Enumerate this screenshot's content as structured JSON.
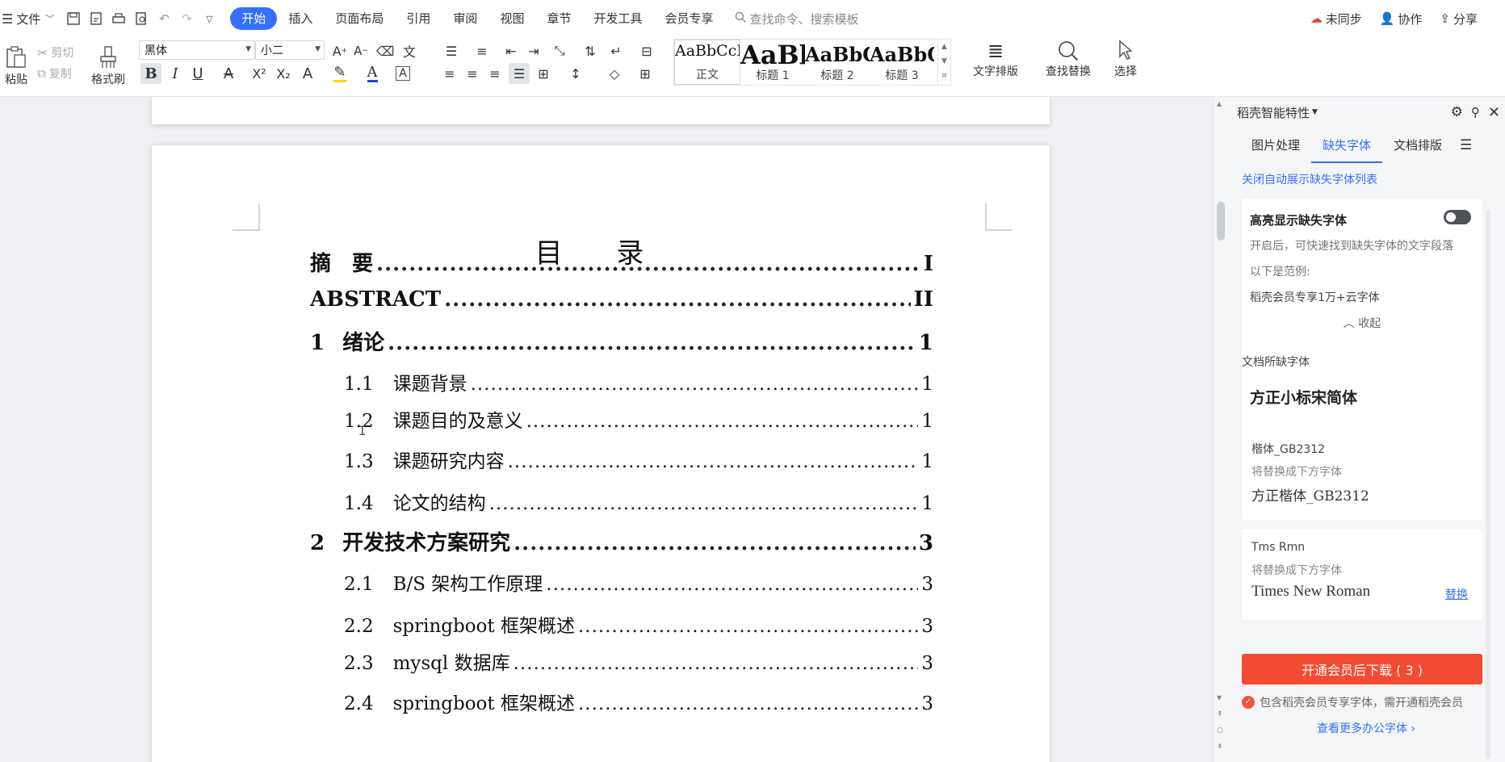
{
  "menubar": {
    "menu_label": "文件",
    "tabs": [
      "开始",
      "插入",
      "页面布局",
      "引用",
      "审阅",
      "视图",
      "章节",
      "开发工具",
      "会员专享"
    ],
    "search_placeholder": "查找命令、搜索模板",
    "right": {
      "sync": "未同步",
      "collab": "协作",
      "share": "分享"
    }
  },
  "ribbon": {
    "paste": "粘贴",
    "cut": "剪切",
    "copy": "复制",
    "format_painter": "格式刷",
    "font_name": "黑体",
    "font_size": "小二",
    "styles": [
      {
        "sample": "AaBbCcDd",
        "name": "正文"
      },
      {
        "sample": "AaBl",
        "name": "标题 1"
      },
      {
        "sample": "AaBbC",
        "name": "标题 2"
      },
      {
        "sample": "AaBbC",
        "name": "标题 3"
      }
    ],
    "text_layout": "文字排版",
    "find_replace": "查找替换",
    "select": "选择"
  },
  "document": {
    "toc_title": "目 录",
    "entries": [
      {
        "level": 1,
        "num": "",
        "title": "摘　要",
        "page": "I"
      },
      {
        "level": 1,
        "num": "",
        "title": "ABSTRACT",
        "page": "II"
      },
      {
        "level": 1,
        "num": "1",
        "title": "绪论",
        "page": "1"
      },
      {
        "level": 2,
        "num": "1.1",
        "title": "课题背景",
        "page": "1"
      },
      {
        "level": 2,
        "num": "1.2",
        "title": "课题目的及意义",
        "page": "1"
      },
      {
        "level": 2,
        "num": "1.3",
        "title": "课题研究内容",
        "page": "1"
      },
      {
        "level": 2,
        "num": "1.4",
        "title": "论文的结构",
        "page": "1"
      },
      {
        "level": 1,
        "num": "2",
        "title": "开发技术方案研究",
        "page": "3"
      },
      {
        "level": 2,
        "num": "2.1",
        "title": "B/S 架构工作原理",
        "page": "3"
      },
      {
        "level": 2,
        "num": "2.2",
        "title": "springboot 框架概述",
        "page": "3"
      },
      {
        "level": 2,
        "num": "2.3",
        "title": "mysql 数据库",
        "page": "3"
      },
      {
        "level": 2,
        "num": "2.4",
        "title": "springboot 框架概述",
        "page": "3"
      }
    ]
  },
  "panel": {
    "title": "稻壳智能特性",
    "tabs": [
      "图片处理",
      "缺失字体",
      "文档排版"
    ],
    "close_auto_link": "关闭自动展示缺失字体列表",
    "highlight_card": {
      "title": "高亮显示缺失字体",
      "desc": "开启后，可快速找到缺失字体的文字段落",
      "example_label": "以下是范例:",
      "example": "稻壳会员专享1万+云字体",
      "collapse": "收起"
    },
    "missing_fonts_label": "文档所缺字体",
    "missing_fonts": [
      {
        "name": "方正小标宋简体"
      },
      {
        "name": "楷体_GB2312",
        "replace_hint": "将替换成下方字体",
        "replacement": "方正楷体_GB2312"
      },
      {
        "name": "Tms Rmn",
        "replace_hint": "将替换成下方字体",
        "replacement": "Times New Roman",
        "action": "替换"
      }
    ],
    "download_button": "开通会员后下载 ( 3 )",
    "member_note": "包含稻壳会员专享字体，需开通稻壳会员",
    "more_link": "查看更多办公字体"
  }
}
